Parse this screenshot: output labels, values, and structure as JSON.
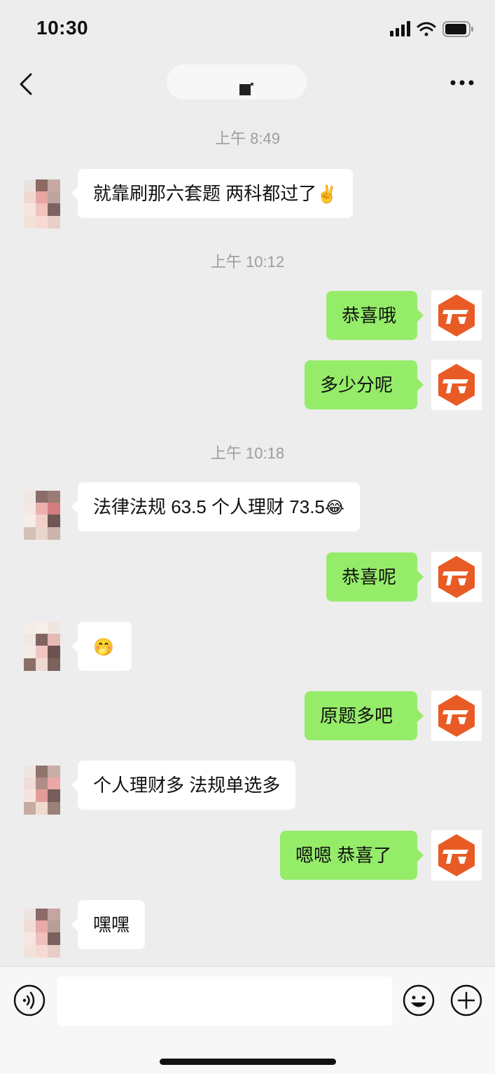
{
  "status": {
    "time": "10:30"
  },
  "header": {
    "title": ""
  },
  "messages": [
    {
      "kind": "timestamp",
      "text": "上午 8:49"
    },
    {
      "kind": "in",
      "text": "就靠刷那六套题 两科都过了",
      "emoji": "✌️"
    },
    {
      "kind": "timestamp",
      "text": "上午 10:12"
    },
    {
      "kind": "out",
      "text": "恭喜哦"
    },
    {
      "kind": "out",
      "text": "多少分呢"
    },
    {
      "kind": "timestamp",
      "text": "上午 10:18"
    },
    {
      "kind": "in",
      "text": "法律法规 63.5 个人理财 73.5",
      "emoji": "😂"
    },
    {
      "kind": "out",
      "text": "恭喜呢"
    },
    {
      "kind": "in",
      "text": "",
      "emoji": "🤭"
    },
    {
      "kind": "out",
      "text": "原题多吧"
    },
    {
      "kind": "in",
      "text": "个人理财多 法规单选多"
    },
    {
      "kind": "out",
      "text": "嗯嗯 恭喜了"
    },
    {
      "kind": "in",
      "text": "嘿嘿"
    }
  ],
  "input": {
    "placeholder": ""
  },
  "colors": {
    "outgoing_bubble": "#95ec69",
    "incoming_bubble": "#ffffff",
    "brand_logo": "#e85b25"
  },
  "icons": [
    "back-icon",
    "more-icon",
    "voice-icon",
    "emoji-icon",
    "plus-icon",
    "signal-icon",
    "wifi-icon",
    "battery-icon"
  ]
}
